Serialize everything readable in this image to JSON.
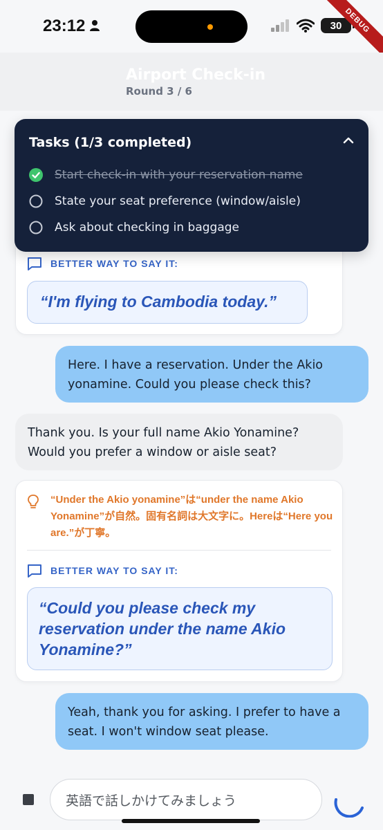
{
  "status_bar": {
    "time": "23:12",
    "battery": "30"
  },
  "debug_label": "DEBUG",
  "app_bar": {
    "title": "Airport Check-in",
    "subtitle": "Round 3 / 6"
  },
  "tasks": {
    "title": "Tasks (1/3 completed)",
    "items": [
      {
        "label": "Start check-in with your reservation name",
        "done": true
      },
      {
        "label": "State your seat preference (window/aisle)",
        "done": false
      },
      {
        "label": "Ask about checking in baggage",
        "done": false
      }
    ]
  },
  "feedback_1": {
    "label": "BETTER WAY TO SAY IT:",
    "suggestion": "“I'm flying to Cambodia today.”"
  },
  "user_msg_1": "Here. I have a reservation. Under the Akio yonamine. Could you please check this?",
  "bot_msg_1": "Thank you. Is your full name Akio Yonamine? Would you prefer a window or aisle seat?",
  "feedback_2": {
    "tip": "“Under the Akio yonamine”は“under the name Akio Yonamine”が自然。固有名詞は大文字に。Hereは“Here you are.”が丁寧。",
    "label": "BETTER WAY TO SAY IT:",
    "suggestion": "“Could you please check my reservation under the name Akio Yonamine?”"
  },
  "user_msg_2": "Yeah, thank you for asking. I prefer to have a seat. I won't window seat please.",
  "input": {
    "placeholder": "英語で話しかけてみましょう"
  },
  "colors": {
    "accent": "#3564c7",
    "task_panel": "#15213a",
    "user_bubble": "#90c8f7",
    "tip": "#e0772a",
    "check": "#3ec46d"
  }
}
